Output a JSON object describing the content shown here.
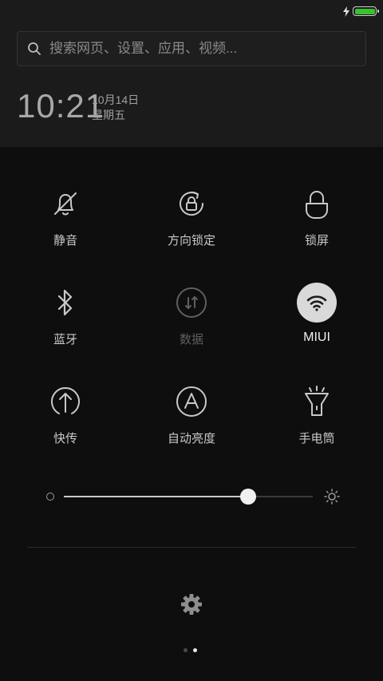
{
  "status_bar": {
    "charging": true,
    "battery_level": 1.0
  },
  "search": {
    "placeholder": "搜索网页、设置、应用、视频..."
  },
  "clock": {
    "time": "10:21",
    "date": "10月14日",
    "weekday": "星期五"
  },
  "toggles": [
    {
      "label": "静音",
      "icon": "bell-off-icon",
      "state": "off"
    },
    {
      "label": "方向锁定",
      "icon": "rotation-lock-icon",
      "state": "off"
    },
    {
      "label": "锁屏",
      "icon": "lock-icon",
      "state": "off"
    },
    {
      "label": "蓝牙",
      "icon": "bluetooth-icon",
      "state": "off"
    },
    {
      "label": "数据",
      "icon": "mobile-data-icon",
      "state": "disabled"
    },
    {
      "label": "MIUI",
      "icon": "wifi-icon",
      "state": "on"
    },
    {
      "label": "快传",
      "icon": "quick-transfer-icon",
      "state": "off"
    },
    {
      "label": "自动亮度",
      "icon": "auto-brightness-icon",
      "state": "off"
    },
    {
      "label": "手电筒",
      "icon": "flashlight-icon",
      "state": "off"
    }
  ],
  "brightness": {
    "value": 0.74
  },
  "pager": {
    "pages": 2,
    "current": 2
  },
  "colors": {
    "background": "#0e0e0e",
    "header": "#1b1b1b",
    "battery": "#37c22f",
    "active_toggle": "#d9d9d9"
  }
}
